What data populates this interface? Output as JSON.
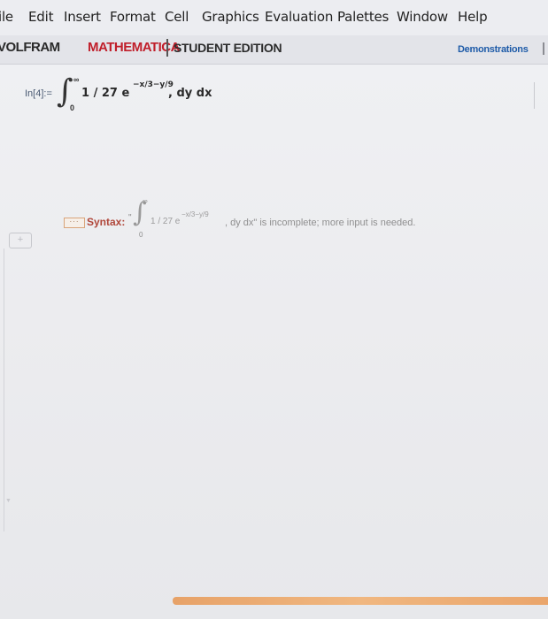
{
  "menu": [
    "ile",
    "Edit",
    "Insert",
    "Format",
    "Cell",
    "Graphics",
    "Evaluation",
    "Palettes",
    "Window",
    "Help"
  ],
  "banner": {
    "brand_part1": "VOLFRAM",
    "brand_part2": "MATHEMATICA",
    "edition": "STUDENT EDITION",
    "demonstrations": "Demonstrations"
  },
  "cell": {
    "in_label": "In[4]:=",
    "integral_sign": "∫",
    "upper_limit": "∞",
    "lower_limit": "0",
    "integrand": "1 / 27 e",
    "exponent": "−x/3−y/9",
    "tail": ", dy dx"
  },
  "message": {
    "dots": "···",
    "label": "Syntax:",
    "quote_open": "\"",
    "integral_sign": "∫",
    "upper_limit": "∞",
    "lower_limit": "0",
    "integrand": "1 / 27 e",
    "exponent": "−x/3−y/9",
    "text": ", dy dx\" is incomplete; more input is needed."
  },
  "insert_glyph": "+",
  "colors": {
    "brand_red": "#c01e2a",
    "syntax_red": "#b0473a",
    "link_blue": "#1e5ba8",
    "progress_orange": "#f0b780"
  }
}
